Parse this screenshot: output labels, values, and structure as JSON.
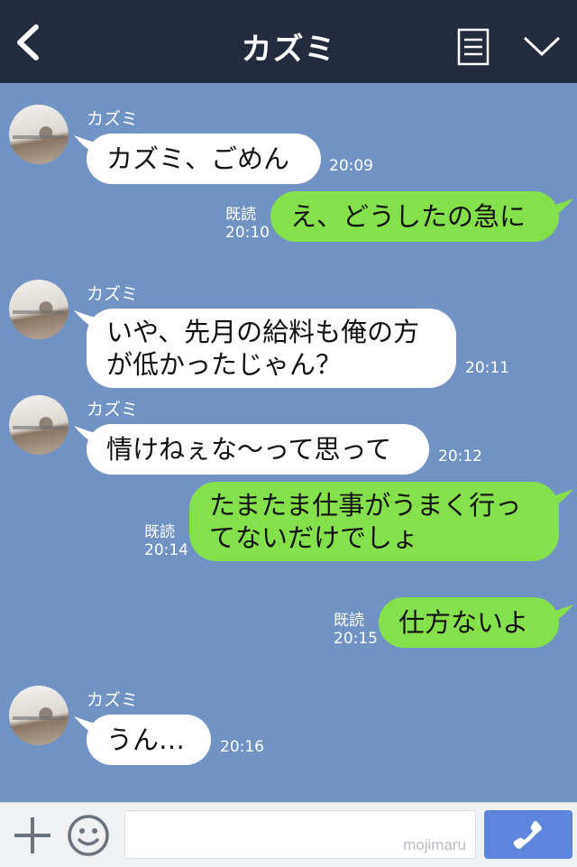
{
  "header": {
    "title": "カズミ"
  },
  "contact": {
    "name": "カズミ"
  },
  "messages": [
    {
      "text": "カズミ、ごめん",
      "time": "20:09"
    },
    {
      "text": "え、どうしたの急に",
      "read": "既読",
      "time": "20:10"
    },
    {
      "text": "いや、先月の給料も俺の方\nが低かったじゃん？",
      "time": "20:11"
    },
    {
      "text": "情けねぇな〜って思って",
      "time": "20:12"
    },
    {
      "text": "たまたま仕事がうまく行っ\nてないだけでしょ",
      "read": "既読",
      "time": "20:14"
    },
    {
      "text": "仕方ないよ",
      "read": "既読",
      "time": "20:15"
    },
    {
      "text": "うん…",
      "time": "20:16"
    }
  ],
  "input": {
    "watermark": "mojimaru"
  },
  "colors": {
    "header": "#232b3f",
    "background": "#7193c4",
    "incoming": "#ffffff",
    "outgoing": "#84e14c",
    "call_button": "#5c85db"
  },
  "icons": [
    "back-chevron-icon",
    "menu-list-icon",
    "chevron-down-icon",
    "plus-icon",
    "emoji-icon",
    "phone-icon"
  ]
}
